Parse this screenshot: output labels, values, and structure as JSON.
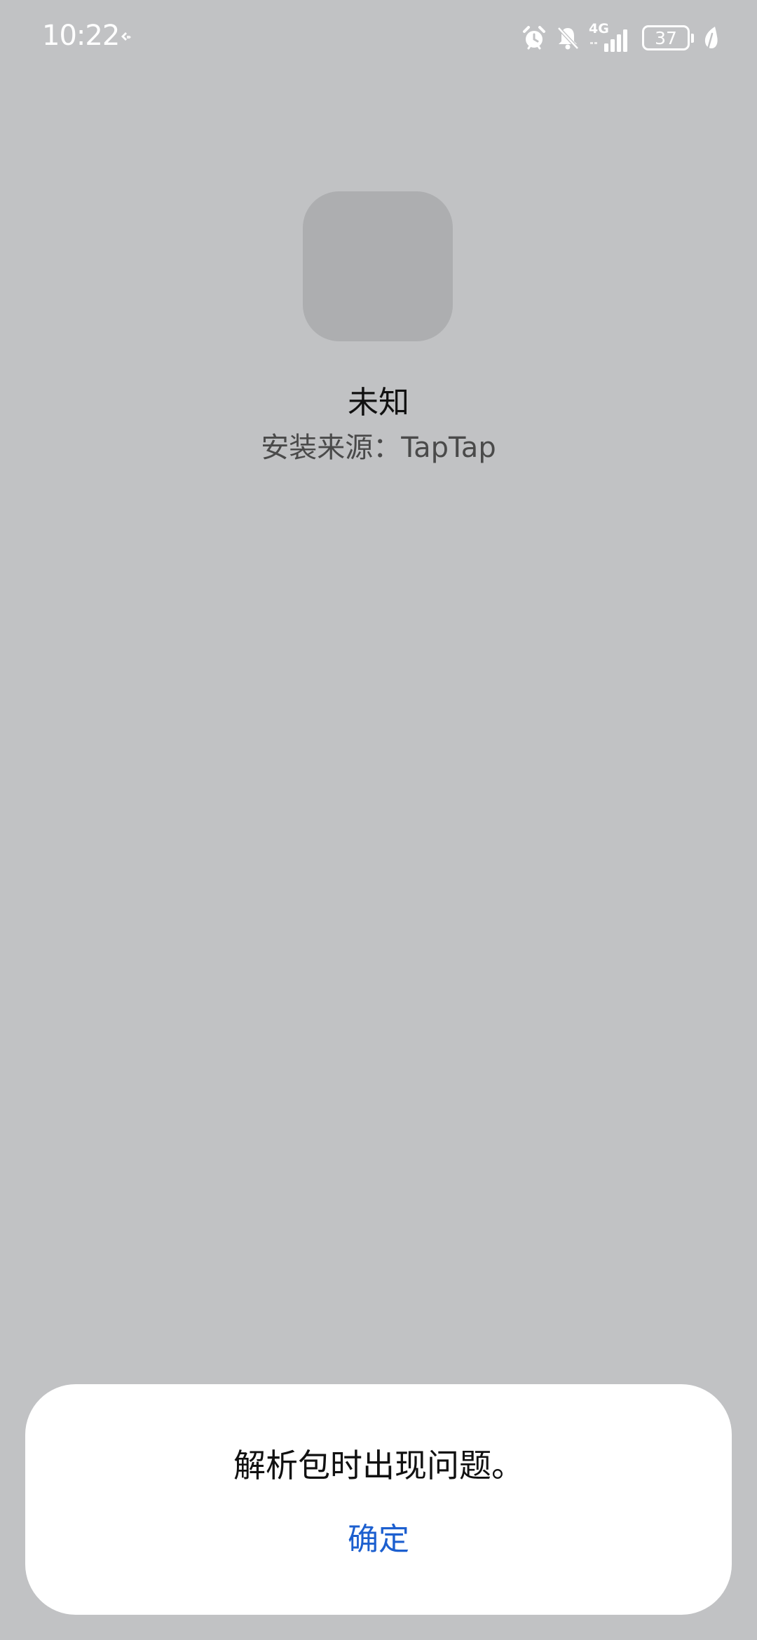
{
  "status_bar": {
    "time": "10:22",
    "network_type": "4G",
    "battery_level": "37",
    "icons": [
      "usb-debug-icon",
      "alarm-icon",
      "mute-icon",
      "signal-icon",
      "battery-icon",
      "leaf-icon"
    ]
  },
  "app": {
    "name": "未知",
    "install_source": "安装来源：TapTap"
  },
  "dialog": {
    "message": "解析包时出现问题。",
    "confirm_label": "确定"
  },
  "colors": {
    "background": "#c1c2c4",
    "icon_placeholder": "#adaeb0",
    "dialog_background": "#ffffff",
    "accent": "#1c5fcf"
  }
}
